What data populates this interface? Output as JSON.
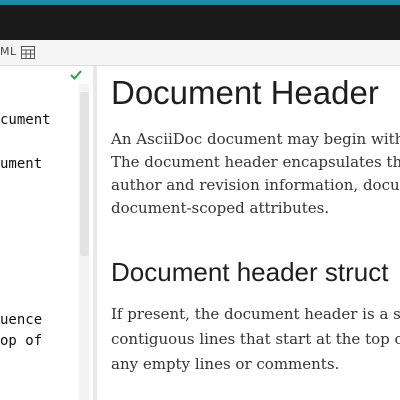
{
  "toolbar": {
    "format_label": "ML"
  },
  "editor": {
    "lines": [
      "cument",
      "ument",
      "uence",
      "op of"
    ]
  },
  "preview": {
    "heading": "Document Header",
    "intro": [
      "An AsciiDoc document may begin with",
      "The document header encapsulates th",
      "author and revision information, docu",
      "document-scoped attributes."
    ],
    "subheading": "Document header struct",
    "body": [
      "If present, the document header is a se",
      "contiguous lines that start at the top of",
      "any empty lines or comments."
    ]
  },
  "colors": {
    "accent": "#1f8a9e",
    "check": "#2e9e3e"
  }
}
